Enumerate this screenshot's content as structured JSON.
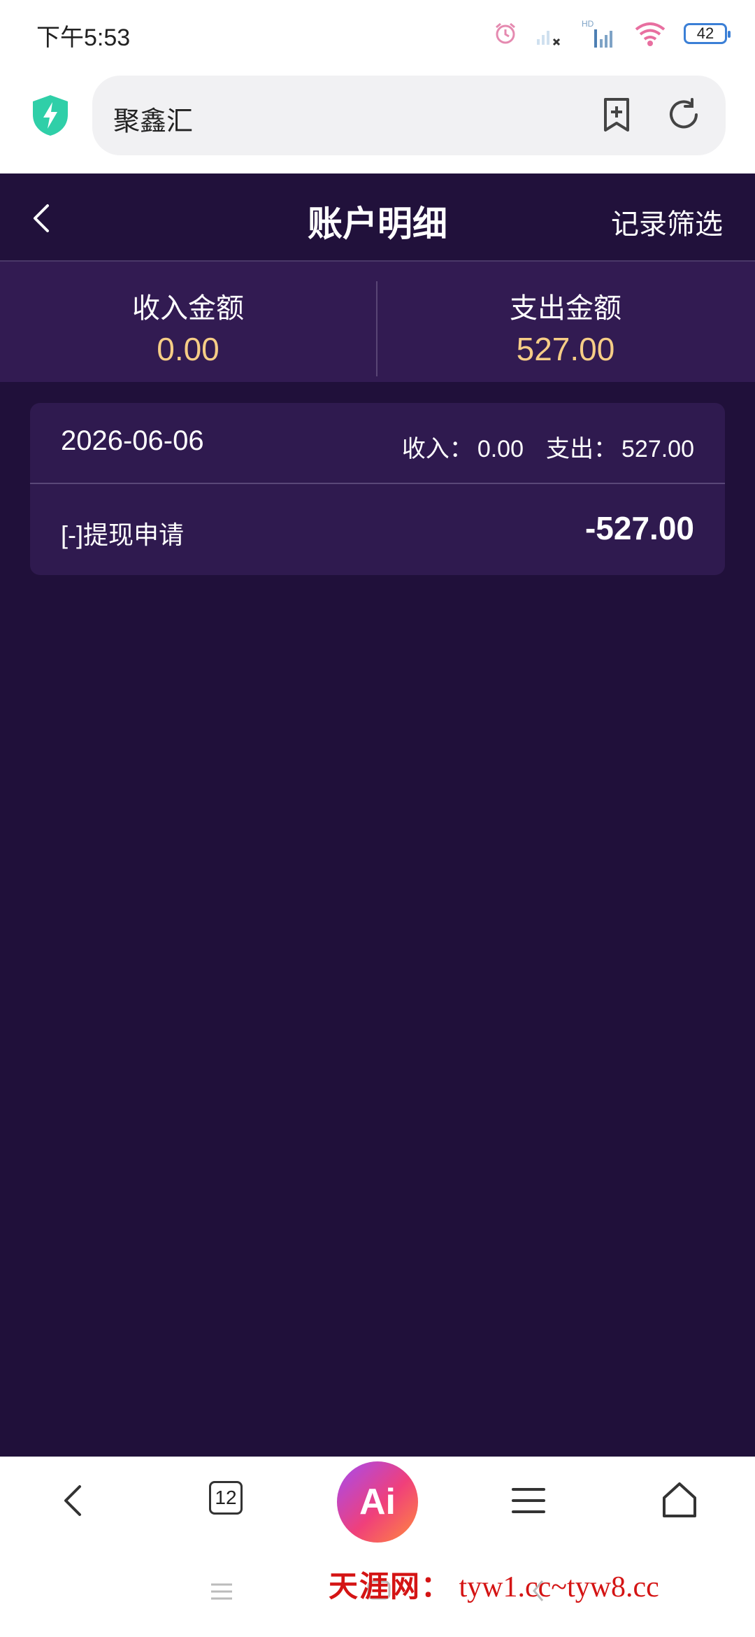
{
  "status_bar": {
    "time": "下午5:53",
    "battery": "42",
    "icons": [
      "alarm-icon",
      "signal-icon",
      "hd-signal-icon",
      "wifi-icon",
      "battery-icon"
    ]
  },
  "browser": {
    "url_text": "聚鑫汇",
    "icons": [
      "shield-bolt-icon",
      "add-bookmark-icon",
      "refresh-icon"
    ]
  },
  "header": {
    "title": "账户明细",
    "filter_label": "记录筛选"
  },
  "summary": {
    "income_label": "收入金额",
    "income_value": "0.00",
    "expense_label": "支出金额",
    "expense_value": "527.00"
  },
  "records": [
    {
      "date": "2026-06-06",
      "income_label": "收入：",
      "income": "0.00",
      "expense_label": "支出：",
      "expense": "527.00",
      "items": [
        {
          "label": "[-]提现申请",
          "amount": "-527.00"
        }
      ]
    }
  ],
  "toolbar": {
    "tabs_count": "12",
    "ai_label": "Ai"
  },
  "watermark": {
    "site": "天涯网：",
    "domains": "tyw1.cc~tyw8.cc"
  },
  "colors": {
    "page_bg": "#20103a",
    "summary_bg": "#321b52",
    "card_bg": "#2f1a4f",
    "amount_gold": "#f6cd86",
    "watermark_red": "#d41414"
  }
}
